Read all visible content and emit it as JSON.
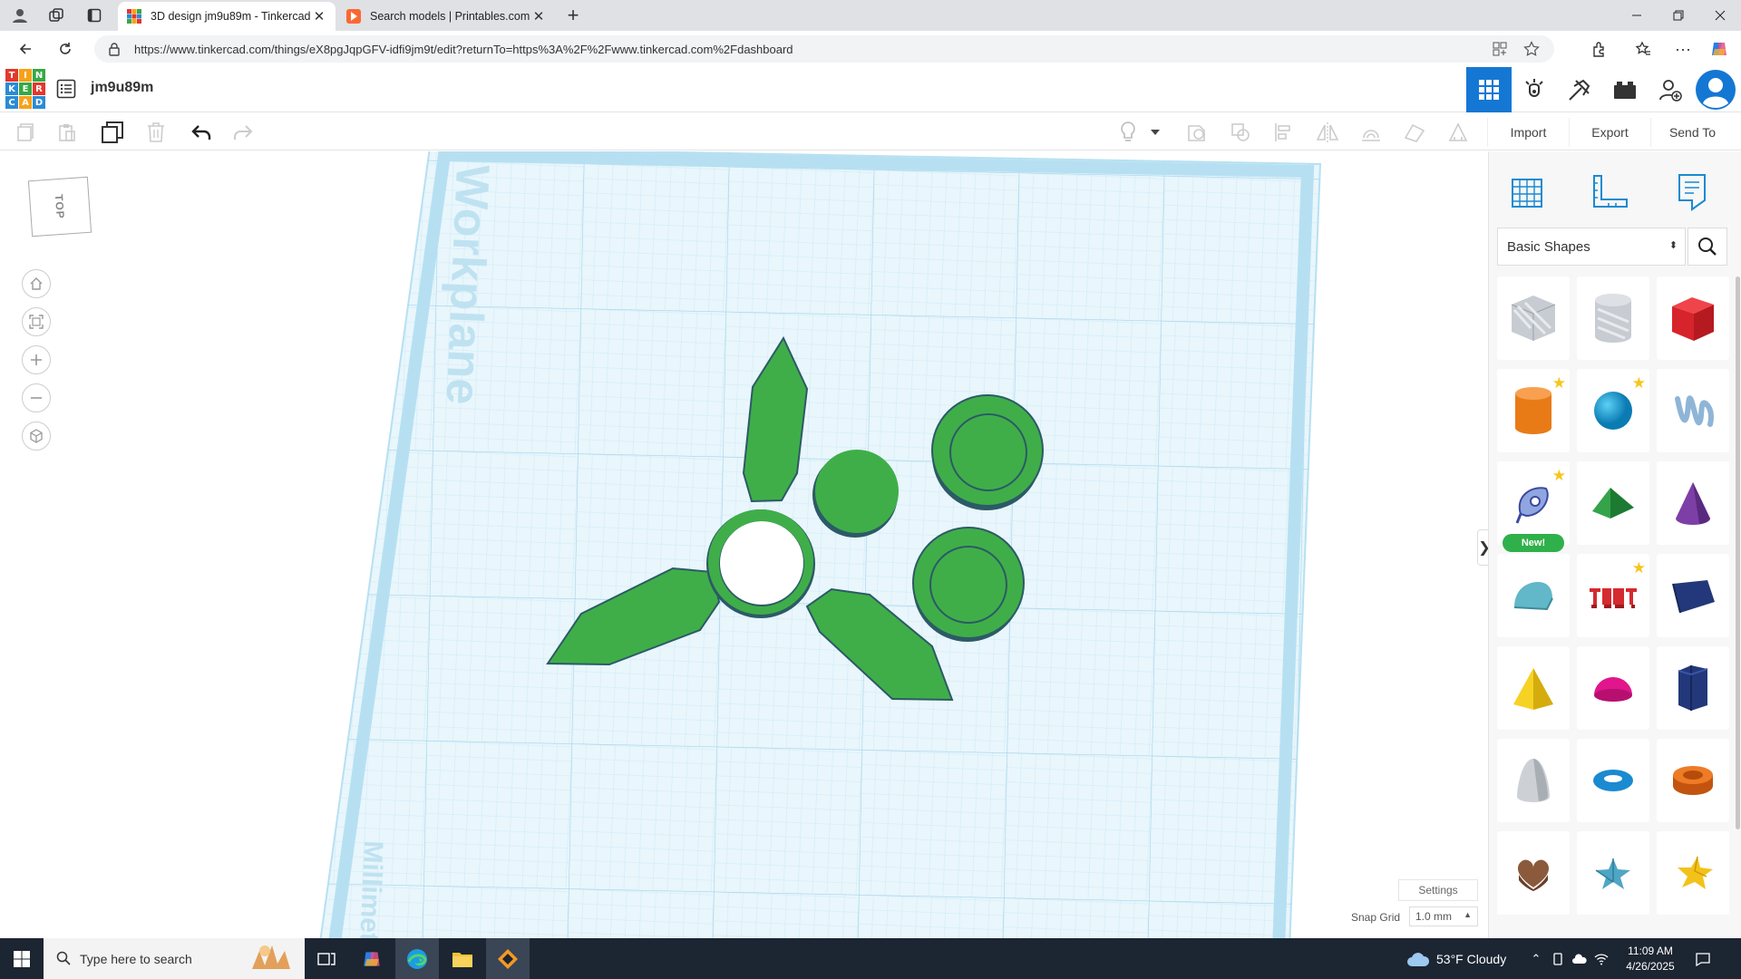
{
  "browser": {
    "tabs": [
      {
        "title": "3D design jm9u89m - Tinkercad",
        "active": true
      },
      {
        "title": "Search models | Printables.com",
        "active": false
      }
    ],
    "url": "https://www.tinkercad.com/things/eX8pgJqpGFV-idfi9jm9t/edit?returnTo=https%3A%2F%2Fwww.tinkercad.com%2Fdashboard"
  },
  "app": {
    "logo_letters": [
      "T",
      "I",
      "N",
      "K",
      "E",
      "R",
      "C",
      "A",
      "D"
    ],
    "design_name": "jm9u89m",
    "header_buttons": [
      "3d-view-icon",
      "sim-lab-icon",
      "blocks-icon",
      "bricks-icon",
      "add-user-icon",
      "avatar"
    ]
  },
  "toolbar": {
    "import_label": "Import",
    "export_label": "Export",
    "send_to_label": "Send To"
  },
  "workspace": {
    "viewcube_label": "TOP",
    "workplane_label": "Workplane",
    "units_label": "Millimeters",
    "settings_label": "Settings",
    "snap_grid_label": "Snap Grid",
    "snap_grid_value": "1.0 mm",
    "shape_color": "#3fae49",
    "grid_color": "#a9dcef"
  },
  "panel": {
    "category": "Basic Shapes",
    "new_badge": "New!",
    "shapes": [
      "box-hole",
      "cylinder-hole",
      "box",
      "cylinder",
      "sphere",
      "scribble",
      "shape-generator",
      "roof",
      "cone",
      "round-roof",
      "text",
      "wedge",
      "pyramid",
      "half-sphere",
      "polygon",
      "paraboloid",
      "torus",
      "tube",
      "heart",
      "star",
      "star-gold"
    ]
  },
  "taskbar": {
    "search_placeholder": "Type here to search",
    "weather": "53°F  Cloudy",
    "time": "11:09 AM",
    "date": "4/26/2025"
  }
}
